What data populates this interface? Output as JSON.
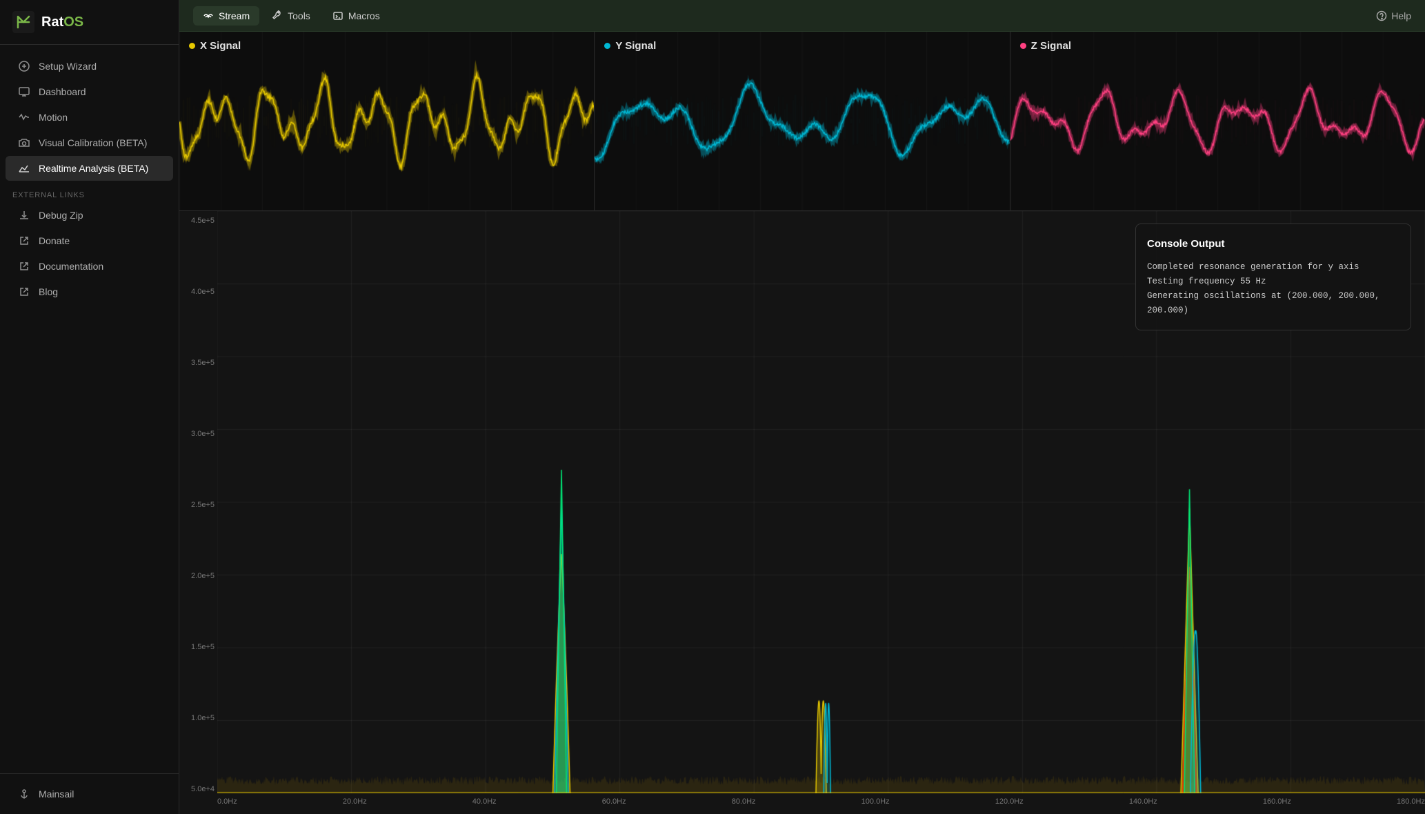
{
  "app": {
    "name": "RatOS",
    "logo_letter": "Rat",
    "logo_suffix": "OS"
  },
  "sidebar": {
    "nav_items": [
      {
        "id": "setup-wizard",
        "label": "Setup Wizard",
        "icon": "wand",
        "active": false
      },
      {
        "id": "dashboard",
        "label": "Dashboard",
        "icon": "monitor",
        "active": false
      },
      {
        "id": "motion",
        "label": "Motion",
        "icon": "activity",
        "active": false
      },
      {
        "id": "visual-calibration",
        "label": "Visual Calibration (BETA)",
        "icon": "camera",
        "active": false
      },
      {
        "id": "realtime-analysis",
        "label": "Realtime Analysis (BETA)",
        "icon": "chart",
        "active": true
      }
    ],
    "external_links_label": "External Links",
    "external_links": [
      {
        "id": "debug-zip",
        "label": "Debug Zip",
        "icon": "download"
      },
      {
        "id": "donate",
        "label": "Donate",
        "icon": "external"
      },
      {
        "id": "documentation",
        "label": "Documentation",
        "icon": "external"
      },
      {
        "id": "blog",
        "label": "Blog",
        "icon": "external"
      }
    ],
    "bottom_items": [
      {
        "id": "mainsail",
        "label": "Mainsail",
        "icon": "anchor"
      }
    ]
  },
  "topnav": {
    "items": [
      {
        "id": "stream",
        "label": "Stream",
        "active": true,
        "icon": "signal"
      },
      {
        "id": "tools",
        "label": "Tools",
        "active": false,
        "icon": "wrench"
      },
      {
        "id": "macros",
        "label": "Macros",
        "active": false,
        "icon": "terminal"
      }
    ],
    "help_label": "Help"
  },
  "signals": [
    {
      "id": "x-signal",
      "label": "X Signal",
      "color": "#e6c800",
      "dot_color": "#e6c800"
    },
    {
      "id": "y-signal",
      "label": "Y Signal",
      "color": "#00b8d4",
      "dot_color": "#00b8d4"
    },
    {
      "id": "z-signal",
      "label": "Z Signal",
      "color": "#ff4081",
      "dot_color": "#ff4081"
    }
  ],
  "spectrum": {
    "y_labels": [
      "4.5e+5",
      "4.0e+5",
      "3.5e+5",
      "3.0e+5",
      "2.5e+5",
      "2.0e+5",
      "1.5e+5",
      "1.0e+5",
      "5.0e+4"
    ],
    "x_labels": [
      "0.0Hz",
      "20.0Hz",
      "40.0Hz",
      "60.0Hz",
      "80.0Hz",
      "100.0Hz",
      "120.0Hz",
      "140.0Hz",
      "160.0Hz",
      "180.0Hz"
    ]
  },
  "console": {
    "title": "Console Output",
    "lines": [
      "Completed resonance generation for y axis",
      "Testing frequency 55 Hz",
      "Generating oscillations at (200.000, 200.000, 200.000)"
    ]
  }
}
